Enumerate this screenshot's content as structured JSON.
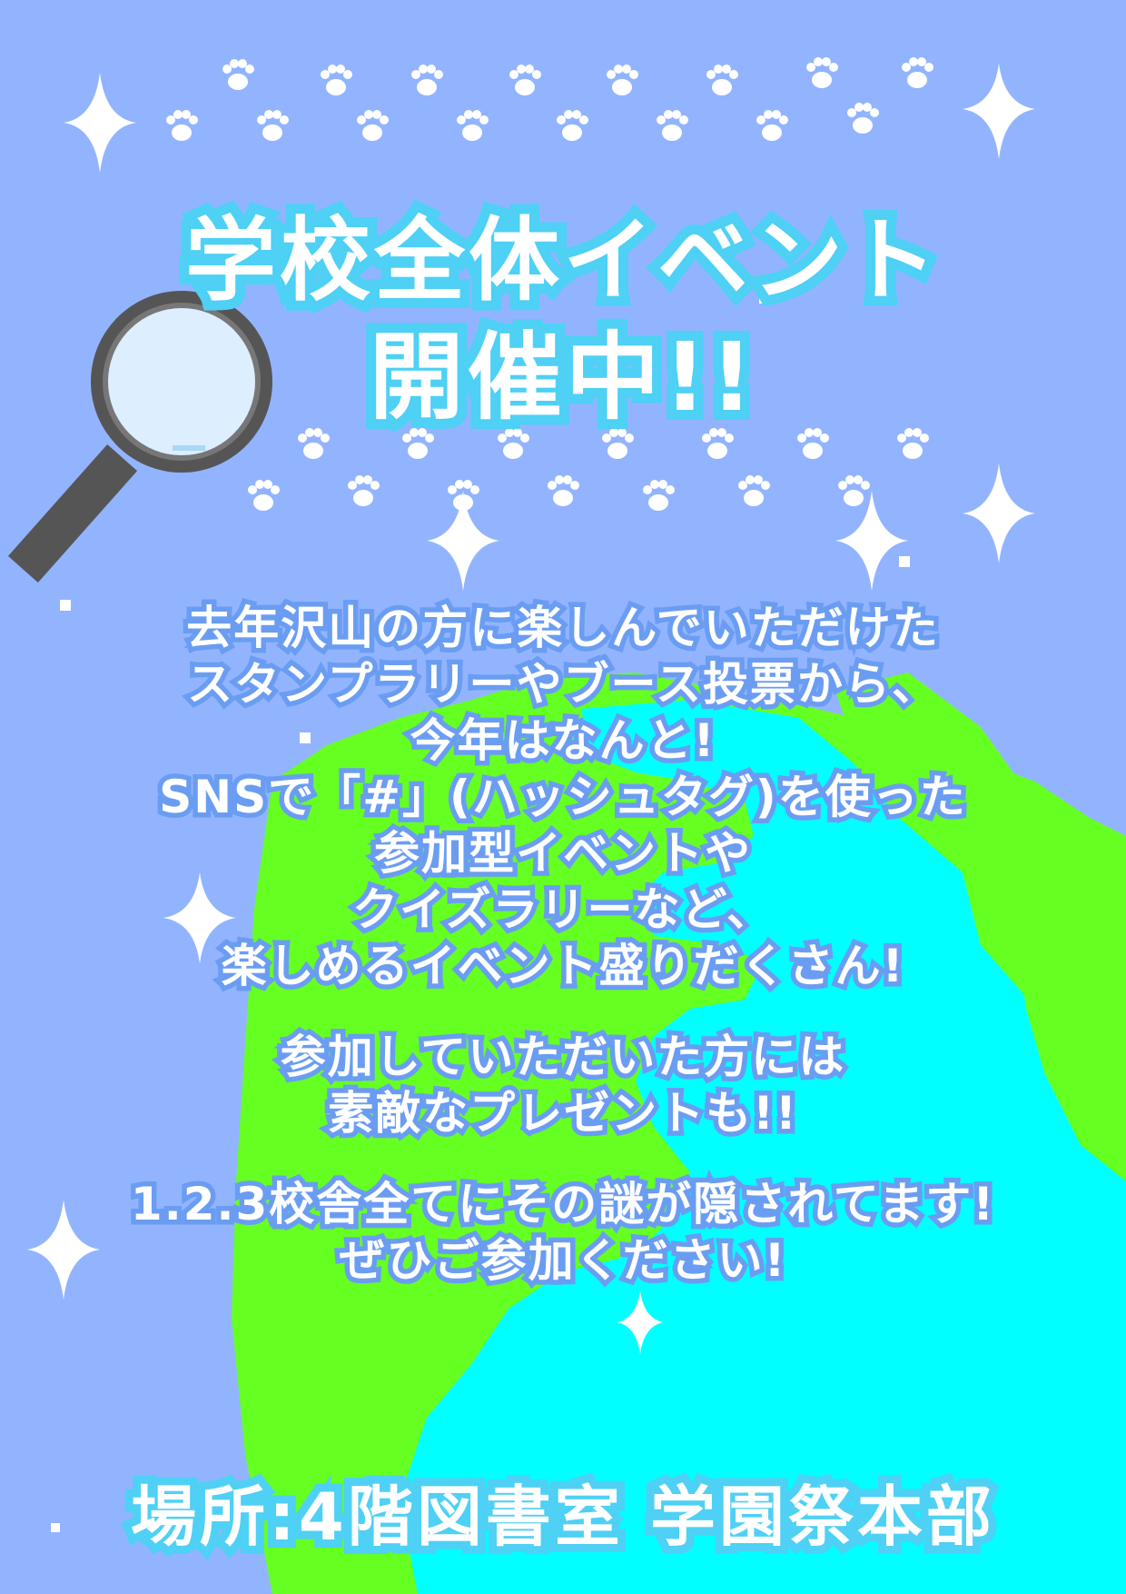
{
  "title": {
    "line1": "学校全体イベント",
    "line2": "開催中!!"
  },
  "body": {
    "lines": [
      "去年沢山の方に楽しんでいただけた",
      "スタンプラリーやブース投票から、",
      "今年はなんと!",
      "SNSで「#」(ハッシュタグ)を使った",
      "参加型イベントや",
      "クイズラリーなど、",
      "楽しめるイベント盛りだくさん!",
      "",
      "参加していただいた方には",
      "素敵なプレゼントも!!",
      "",
      "1.2.3校舎全てにその謎が隠されてます!",
      "ぜひご参加ください!"
    ]
  },
  "footer": {
    "location": "場所:4階図書室 学園祭本部"
  },
  "colors": {
    "background": "#92b4ff",
    "earth_land": "#66ff22",
    "earth_sea": "#00ffff",
    "title_outline": "#4fd0f5",
    "body_outline": "#6a9df2",
    "text": "#ffffff",
    "magnifier_frame": "#555555",
    "magnifier_lens": "#ddeeff"
  },
  "icons": {
    "decor": [
      "paw-print-icon",
      "sparkle-icon",
      "magnifying-glass-icon",
      "earth-globe-icon"
    ]
  }
}
